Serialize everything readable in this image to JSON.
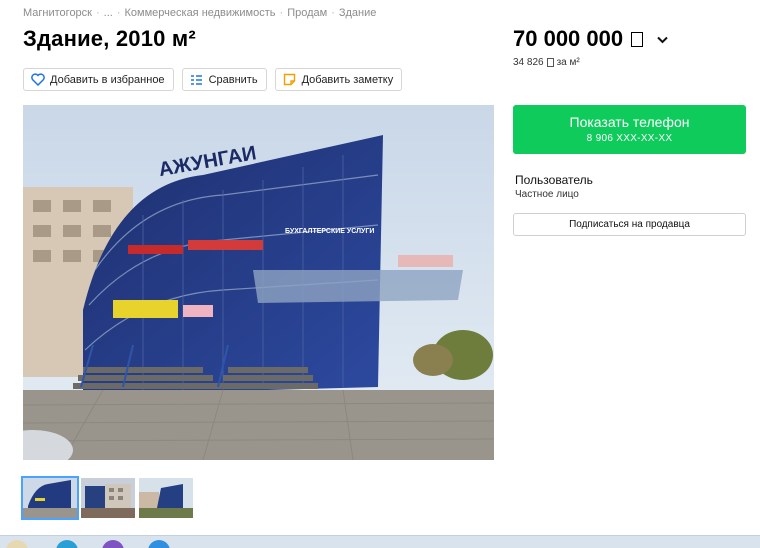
{
  "breadcrumb": {
    "items": [
      "Магнитогорск",
      "...",
      "Коммерческая недвижимость",
      "Продам",
      "Здание"
    ]
  },
  "listing": {
    "title": "Здание, 2010 м²",
    "price": "70 000 000",
    "price_per_m2_value": "34 826",
    "price_per_m2_unit": "за м²"
  },
  "actions": {
    "favorite_label": "Добавить в избранное",
    "compare_label": "Сравнить",
    "note_label": "Добавить заметку"
  },
  "contact": {
    "button_label": "Показать телефон",
    "phone_masked": "8 906 XXX-XX-XX"
  },
  "seller": {
    "name": "Пользователь",
    "type": "Частное лицо",
    "subscribe_label": "Подписаться на продавца"
  },
  "photo": {
    "sign_main": "АЖУНГАИ",
    "sign_services": "БУХГАЛТЕРСКИЕ УСЛУГИ",
    "thumb_count": 3
  },
  "colors": {
    "accent_green": "#0fcb5c",
    "link_gray": "#8c8c8c",
    "thumb_active": "#4aa3ff"
  },
  "icons": [
    "heart-icon",
    "compare-icon",
    "note-icon",
    "ruble-icon",
    "chevron-down-icon"
  ]
}
